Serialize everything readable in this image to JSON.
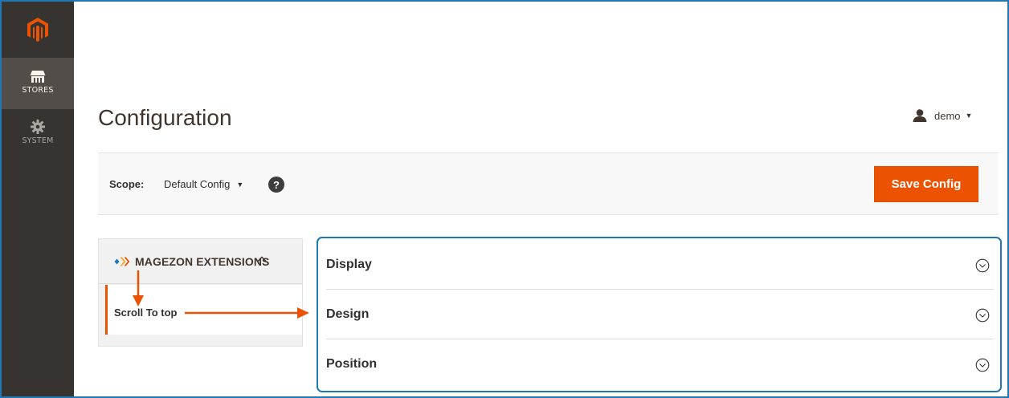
{
  "sidebar": {
    "logo": "magento-logo",
    "items": [
      {
        "label": "STORES",
        "icon": "store-icon",
        "active": true
      },
      {
        "label": "SYSTEM",
        "icon": "gear-icon",
        "active": false
      }
    ]
  },
  "header": {
    "title": "Configuration",
    "user": "demo",
    "user_icon": "user-icon"
  },
  "scope": {
    "label": "Scope:",
    "value": "Default Config",
    "help": "?"
  },
  "actions": {
    "save_label": "Save Config"
  },
  "tabs": {
    "section_title": "MAGEZON EXTENSIONS",
    "items": [
      {
        "label": "Scroll To top",
        "active": true
      }
    ]
  },
  "groups": [
    {
      "title": "Display"
    },
    {
      "title": "Design"
    },
    {
      "title": "Position"
    }
  ],
  "colors": {
    "accent": "#eb5202",
    "sidebar": "#373330",
    "annotation": "#1f78b4"
  }
}
